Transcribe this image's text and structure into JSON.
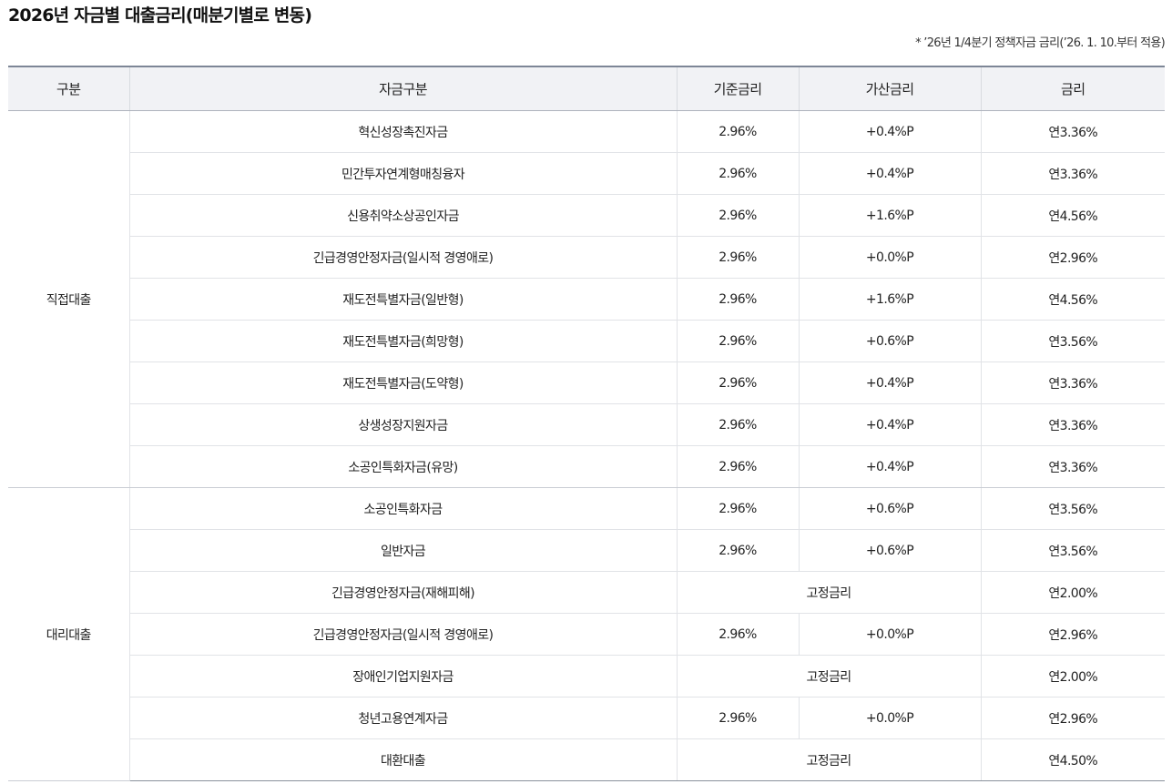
{
  "page": {
    "title": "2026년 자금별 대출금리(매분기별로 변동)",
    "note": "* ’26년 1/4분기 정책자금 금리(’26. 1. 10.부터 적용)"
  },
  "table": {
    "headers": {
      "category": "구분",
      "fund": "자금구분",
      "base_rate": "기준금리",
      "add_rate": "가산금리",
      "rate": "금리"
    },
    "groups": [
      {
        "label": "직접대출",
        "rows": [
          {
            "fund": "혁신성장촉진자금",
            "base": "2.96%",
            "add": "+0.4%P",
            "rate": "연3.36%"
          },
          {
            "fund": "민간투자연계형매칭융자",
            "base": "2.96%",
            "add": "+0.4%P",
            "rate": "연3.36%"
          },
          {
            "fund": "신용취약소상공인자금",
            "base": "2.96%",
            "add": "+1.6%P",
            "rate": "연4.56%"
          },
          {
            "fund": "긴급경영안정자금(일시적 경영애로)",
            "base": "2.96%",
            "add": "+0.0%P",
            "rate": "연2.96%"
          },
          {
            "fund": "재도전특별자금(일반형)",
            "base": "2.96%",
            "add": "+1.6%P",
            "rate": "연4.56%"
          },
          {
            "fund": "재도전특별자금(희망형)",
            "base": "2.96%",
            "add": "+0.6%P",
            "rate": "연3.56%"
          },
          {
            "fund": "재도전특별자금(도약형)",
            "base": "2.96%",
            "add": "+0.4%P",
            "rate": "연3.36%"
          },
          {
            "fund": "상생성장지원자금",
            "base": "2.96%",
            "add": "+0.4%P",
            "rate": "연3.36%"
          },
          {
            "fund": "소공인특화자금(유망)",
            "base": "2.96%",
            "add": "+0.4%P",
            "rate": "연3.36%"
          }
        ]
      },
      {
        "label": "대리대출",
        "rows": [
          {
            "fund": "소공인특화자금",
            "base": "2.96%",
            "add": "+0.6%P",
            "rate": "연3.56%"
          },
          {
            "fund": "일반자금",
            "base": "2.96%",
            "add": "+0.6%P",
            "rate": "연3.56%"
          },
          {
            "fund": "긴급경영안정자금(재해피해)",
            "fixed": "고정금리",
            "rate": "연2.00%"
          },
          {
            "fund": "긴급경영안정자금(일시적 경영애로)",
            "base": "2.96%",
            "add": "+0.0%P",
            "rate": "연2.96%"
          },
          {
            "fund": "장애인기업지원자금",
            "fixed": "고정금리",
            "rate": "연2.00%"
          },
          {
            "fund": "청년고용연계자금",
            "base": "2.96%",
            "add": "+0.0%P",
            "rate": "연2.96%"
          },
          {
            "fund": "대환대출",
            "fixed": "고정금리",
            "rate": "연4.50%"
          }
        ]
      }
    ]
  }
}
